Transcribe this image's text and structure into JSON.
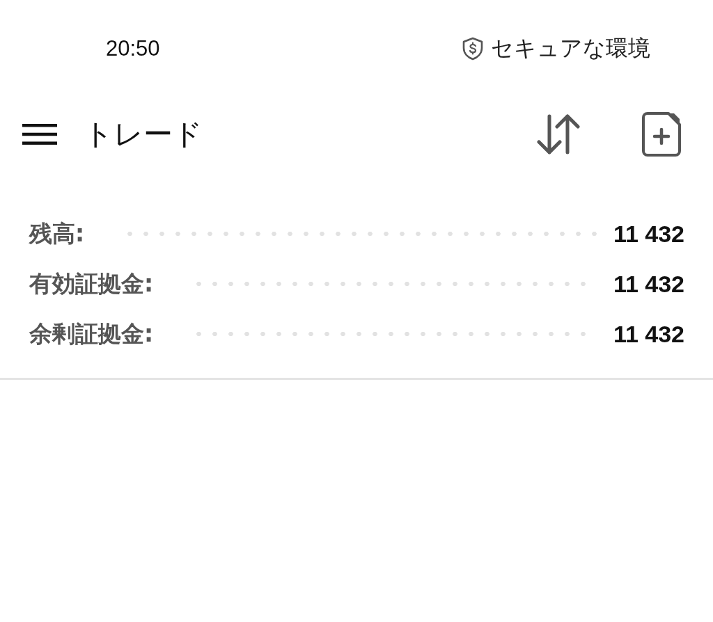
{
  "status_bar": {
    "time": "20:50",
    "security_label": "セキュアな環境"
  },
  "toolbar": {
    "title": "トレード"
  },
  "account_summary": [
    {
      "label": "残高:",
      "value": "11 432"
    },
    {
      "label": "有効証拠金:",
      "value": "11 432"
    },
    {
      "label": "余剰証拠金:",
      "value": "11 432"
    }
  ]
}
